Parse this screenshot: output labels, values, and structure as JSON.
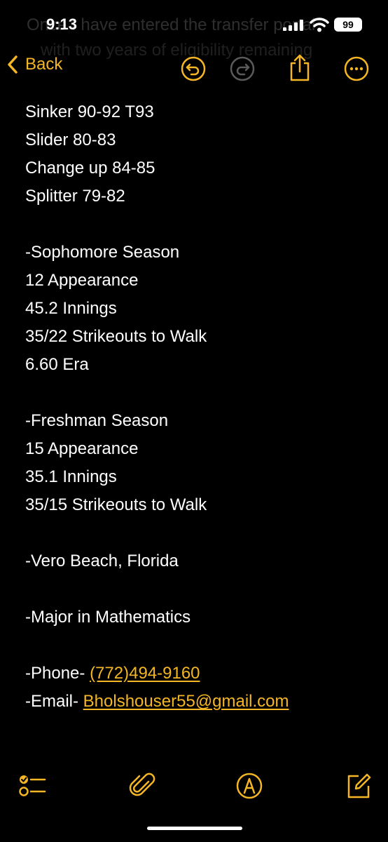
{
  "status": {
    "time": "9:13",
    "battery": "99",
    "ghost_line1": "Once I have entered the transfer portal",
    "ghost_line2": "with two years of eligibility remaining"
  },
  "toolbar": {
    "back_label": "Back"
  },
  "note": {
    "lines": [
      "Sinker 90-92 T93",
      "Slider 80-83",
      "Change up 84-85",
      "Splitter 79-82",
      "",
      "-Sophomore Season",
      "12 Appearance",
      "45.2 Innings",
      "35/22 Strikeouts to Walk",
      "6.60 Era",
      "",
      "-Freshman Season",
      "15 Appearance",
      "35.1 Innings",
      "35/15 Strikeouts to Walk",
      "",
      "-Vero Beach, Florida",
      "",
      "-Major in Mathematics",
      ""
    ],
    "phone_label": "-Phone- ",
    "phone_value": "(772)494-9160",
    "email_label": "-Email- ",
    "email_value": "Bholshouser55@gmail.com"
  },
  "colors": {
    "accent": "#f4b624",
    "background": "#000000",
    "text": "#ffffff"
  },
  "icons": {
    "toolbar": [
      "undo-icon",
      "redo-icon",
      "share-icon",
      "more-icon"
    ],
    "bottom": [
      "checklist-icon",
      "attachment-icon",
      "markup-icon",
      "compose-icon"
    ]
  }
}
